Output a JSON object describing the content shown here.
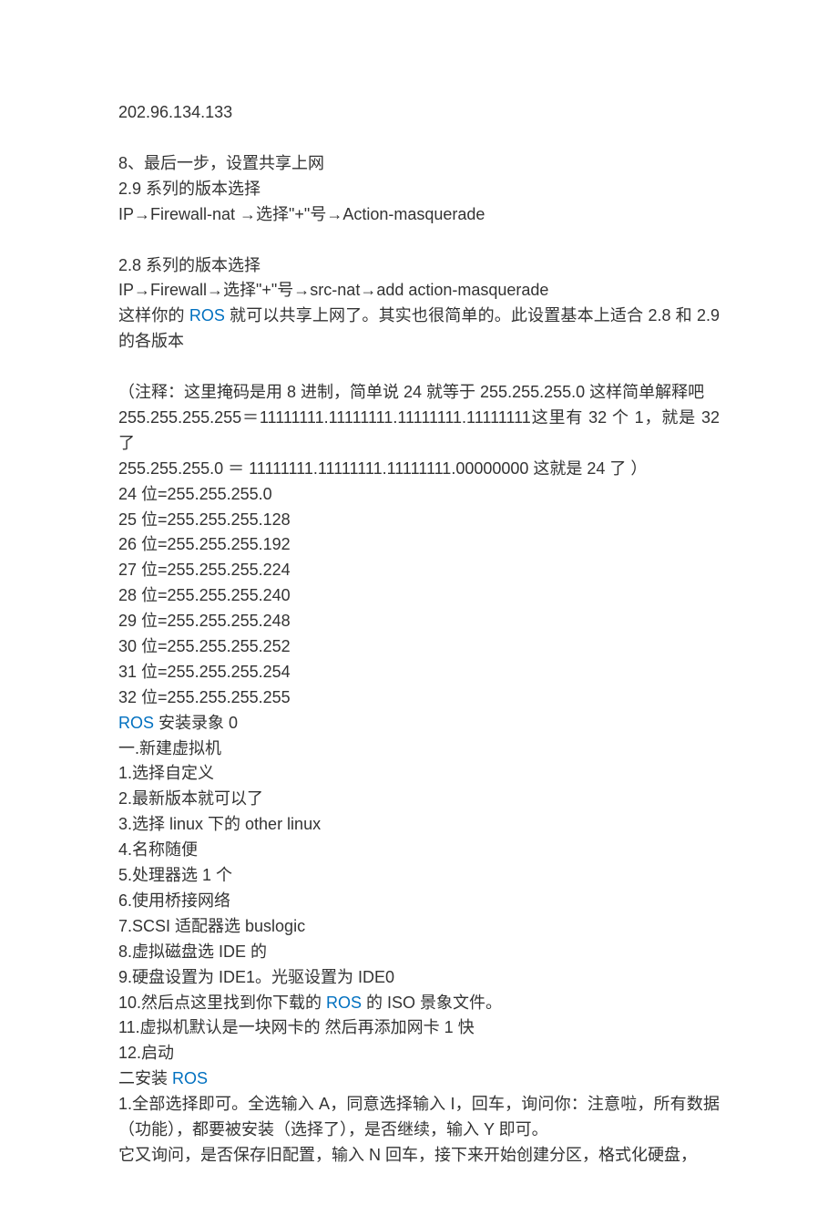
{
  "body": {
    "ip_line": "202.96.134.133",
    "step8_title": "8、最后一步，设置共享上网",
    "version29_label": "2.9 系列的版本选择",
    "version29_path": "IP→Firewall-nat →选择\"+\"号→Action-masquerade",
    "version28_label": "2.8 系列的版本选择",
    "version28_path": "IP→Firewall→选择\"+\"号→src-nat→add action-masquerade",
    "ros_share_prefix": "这样你的 ",
    "ros_link": "ROS",
    "ros_share_suffix": " 就可以共享上网了。其实也很简单的。此设置基本上适合 2.8 和 2.9 的各版本",
    "mask_note_1": "（注释：这里掩码是用 8 进制，简单说 24 就等于 255.255.255.0 这样简单解释吧",
    "mask_note_2": "255.255.255.255＝11111111.11111111.11111111.11111111这里有 32 个 1，就是 32 了",
    "mask_note_3": "255.255.255.0   ＝ 11111111.11111111.11111111.00000000 这就是 24 了 ）",
    "masks": [
      "24 位=255.255.255.0",
      "25 位=255.255.255.128",
      "26 位=255.255.255.192",
      "27 位=255.255.255.224",
      "28 位=255.255.255.240",
      "29 位=255.255.255.248",
      "30 位=255.255.255.252",
      "31 位=255.255.255.254",
      "32 位=255.255.255.255"
    ],
    "ros_install_link": "ROS",
    "ros_install_text": " 安装录象 0",
    "section1_title": "一.新建虚拟机",
    "section1_items": [
      "1.选择自定义",
      "2.最新版本就可以了",
      "3.选择 linux  下的 other linux",
      "4.名称随便",
      "5.处理器选 1 个",
      "6.使用桥接网络",
      "7.SCSI 适配器选 buslogic",
      "8.虚拟磁盘选 IDE 的",
      "9.硬盘设置为 IDE1。光驱设置为 IDE0"
    ],
    "section1_item10_prefix": "10.然后点这里找到你下载的 ",
    "section1_item10_link": "ROS",
    "section1_item10_suffix": " 的 ISO 景象文件。",
    "section1_item11": "11.虚拟机默认是一块网卡的  然后再添加网卡 1 快",
    "section1_item12": "12.启动",
    "section2_prefix": "二安装 ",
    "section2_link": "ROS",
    "section2_item1": "1.全部选择即可。全选输入 A，同意选择输入 I，回车，询问你：注意啦，所有数据（功能），都要被安装（选择了），是否继续，输入 Y 即可。",
    "section2_item1b": "它又询问，是否保存旧配置，输入 N 回车，接下来开始创建分区，格式化硬盘，"
  }
}
